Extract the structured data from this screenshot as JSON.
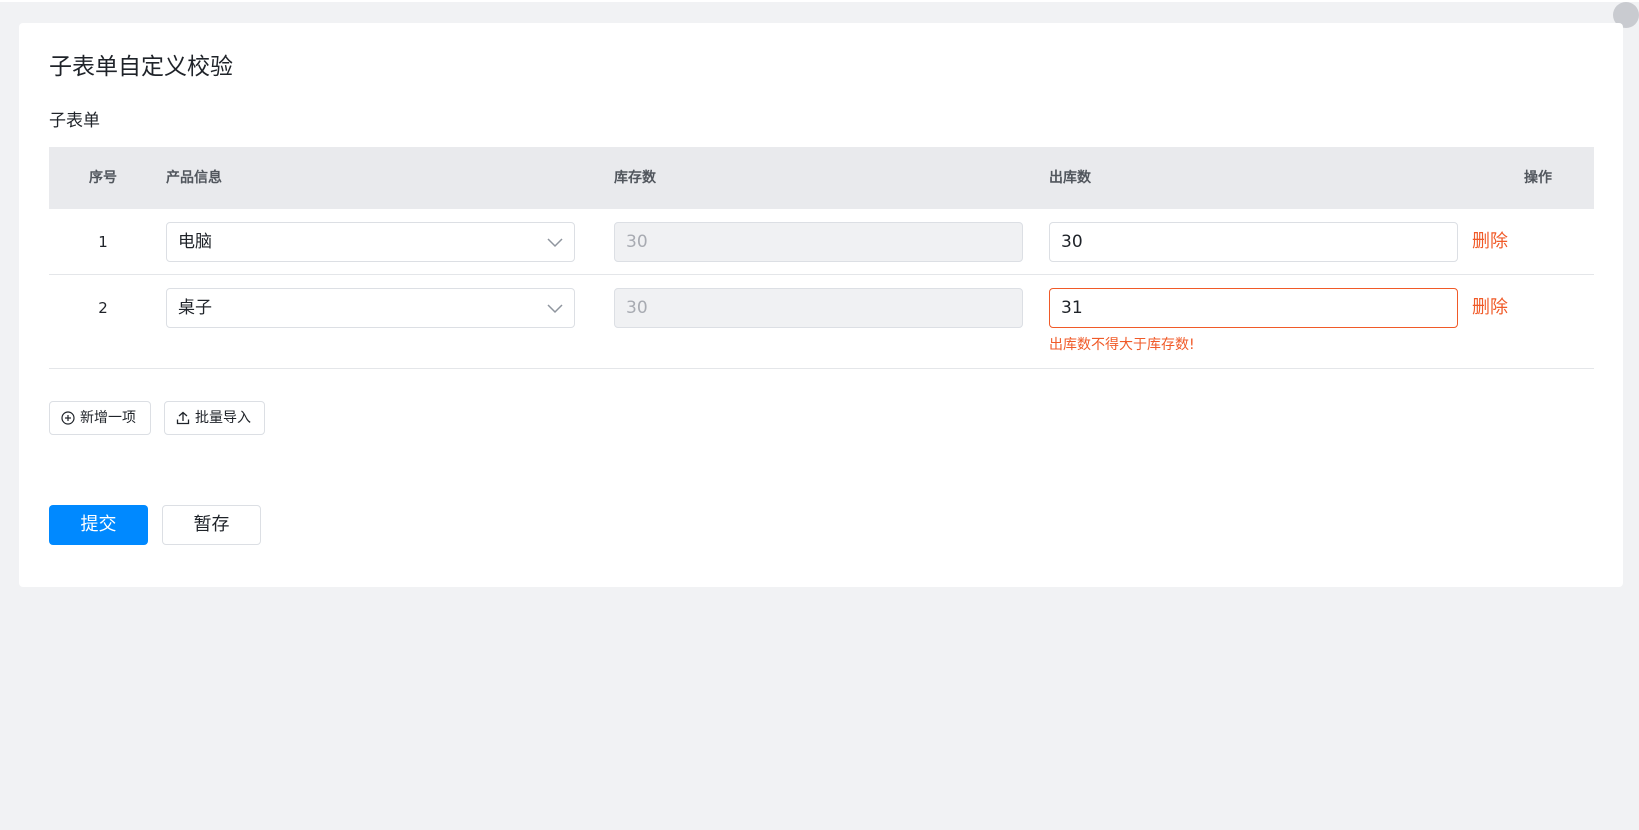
{
  "page": {
    "title": "子表单自定义校验",
    "section_label": "子表单"
  },
  "table": {
    "headers": {
      "index": "序号",
      "product": "产品信息",
      "stock": "库存数",
      "outbound": "出库数",
      "action": "操作"
    },
    "rows": [
      {
        "index": "1",
        "product": "电脑",
        "stock": "30",
        "outbound": "30",
        "delete_label": "删除",
        "error": ""
      },
      {
        "index": "2",
        "product": "桌子",
        "stock": "30",
        "outbound": "31",
        "delete_label": "删除",
        "error": "出库数不得大于库存数!"
      }
    ]
  },
  "toolbar": {
    "add_label": "新增一项",
    "import_label": "批量导入"
  },
  "actions": {
    "submit_label": "提交",
    "save_draft_label": "暂存"
  },
  "colors": {
    "primary": "#0089ff",
    "danger": "#f05a28",
    "header_bg": "#e9eaed",
    "page_bg": "#f1f2f4"
  },
  "icons": {
    "select_arrow": "chevron-down-icon",
    "add": "plus-circle-icon",
    "import": "upload-icon"
  }
}
